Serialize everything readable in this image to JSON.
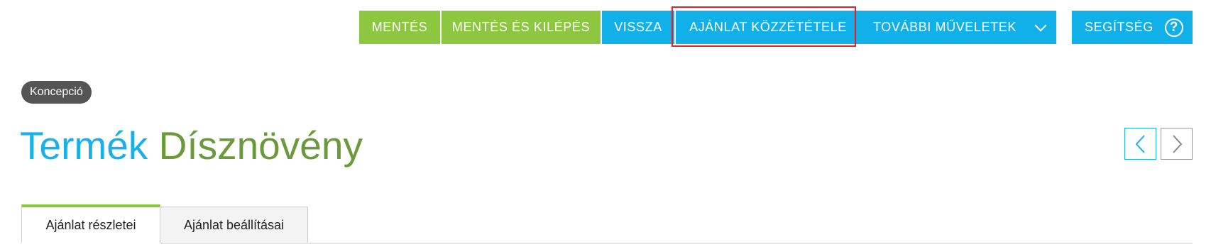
{
  "toolbar": {
    "save_label": "MENTÉS",
    "save_exit_label": "MENTÉS ÉS KILÉPÉS",
    "back_label": "VISSZA",
    "publish_label": "AJÁNLAT KÖZZÉTÉTELE",
    "more_label": "TOVÁBBI MŰVELETEK",
    "help_label": "SEGÍTSÉG"
  },
  "status_badge": "Koncepció",
  "title": {
    "part1": "Termék",
    "part2": "Dísznövény"
  },
  "tabs": [
    {
      "label": "Ajánlat részletei",
      "active": true
    },
    {
      "label": "Ajánlat beállításai",
      "active": false
    }
  ],
  "colors": {
    "green": "#8dc63f",
    "blue": "#12b0e8",
    "title_blue": "#1ab0e8",
    "title_green": "#6a9a3a",
    "badge_bg": "#555555",
    "highlight": "#e0202a"
  },
  "icons": {
    "more_chevron": "chevron-down-icon",
    "help": "question-circle-icon",
    "prev": "chevron-left-icon",
    "next": "chevron-right-icon"
  }
}
